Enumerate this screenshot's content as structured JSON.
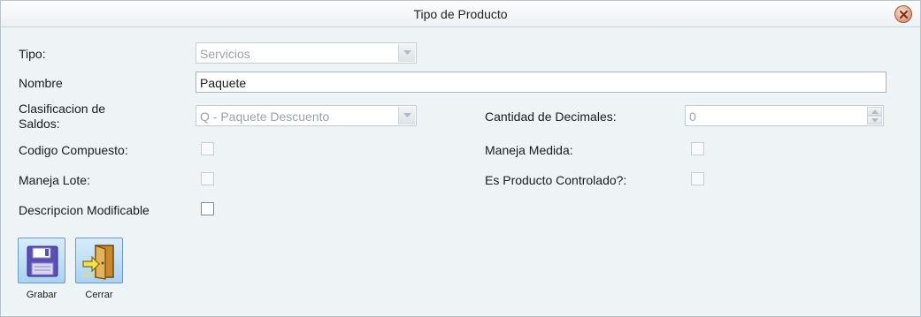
{
  "window": {
    "title": "Tipo de Producto",
    "close_icon": "close-icon"
  },
  "form": {
    "tipo": {
      "label": "Tipo:",
      "value": "Servicios"
    },
    "nombre": {
      "label": "Nombre",
      "value": "Paquete"
    },
    "clasificacion": {
      "label_line1": "Clasificacion de",
      "label_line2": "Saldos:",
      "value": "Q - Paquete Descuento"
    },
    "cantidad_decimales": {
      "label": "Cantidad de Decimales:",
      "value": "0"
    },
    "codigo_compuesto": {
      "label": "Codigo Compuesto:",
      "checked": false
    },
    "maneja_medida": {
      "label": "Maneja Medida:",
      "checked": false
    },
    "maneja_lote": {
      "label": "Maneja Lote:",
      "checked": false
    },
    "es_producto_controlado": {
      "label": "Es Producto Controlado?:",
      "checked": false
    },
    "descripcion_modificable": {
      "label": "Descripcion Modificable",
      "checked": false
    }
  },
  "toolbar": {
    "grabar": {
      "label": "Grabar",
      "icon": "floppy-disk-icon"
    },
    "cerrar": {
      "label": "Cerrar",
      "icon": "exit-door-icon"
    }
  },
  "colors": {
    "accent": "#a9d2f2",
    "background": "#eef3f6"
  }
}
